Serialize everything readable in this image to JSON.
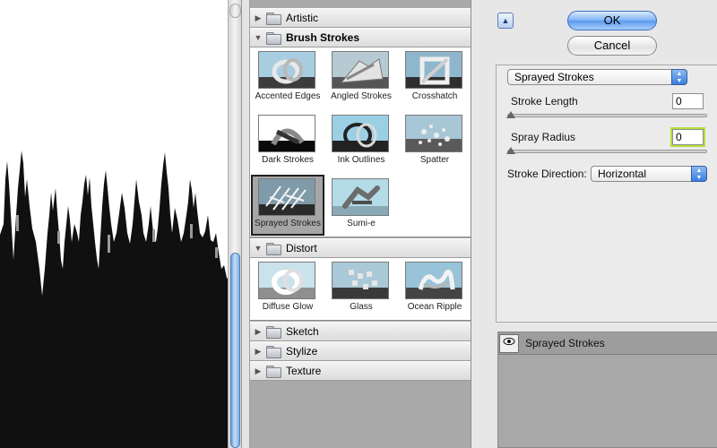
{
  "gallery": {
    "categories": [
      {
        "name": "Artistic",
        "open": false
      },
      {
        "name": "Brush Strokes",
        "open": true
      },
      {
        "name": "Distort",
        "open": true
      },
      {
        "name": "Sketch",
        "open": false
      },
      {
        "name": "Stylize",
        "open": false
      },
      {
        "name": "Texture",
        "open": false
      }
    ],
    "brush_strokes": [
      "Accented Edges",
      "Angled Strokes",
      "Crosshatch",
      "Dark Strokes",
      "Ink Outlines",
      "Spatter",
      "Sprayed Strokes",
      "Sumi-e"
    ],
    "distort": [
      "Diffuse Glow",
      "Glass",
      "Ocean Ripple"
    ],
    "selected": "Sprayed Strokes"
  },
  "buttons": {
    "ok": "OK",
    "cancel": "Cancel"
  },
  "settings": {
    "filter": "Sprayed Strokes",
    "stroke_length_label": "Stroke Length",
    "stroke_length_value": "0",
    "spray_radius_label": "Spray Radius",
    "spray_radius_value": "0",
    "stroke_direction_label": "Stroke Direction:",
    "stroke_direction_value": "Horizontal"
  },
  "layers": {
    "items": [
      {
        "name": "Sprayed Strokes",
        "visible": true
      }
    ]
  },
  "icons": {
    "collapse": "triangle-up-icon",
    "eye": "eye-icon",
    "folder": "folder-icon",
    "disclosure": "disclosure-triangle-icon"
  }
}
